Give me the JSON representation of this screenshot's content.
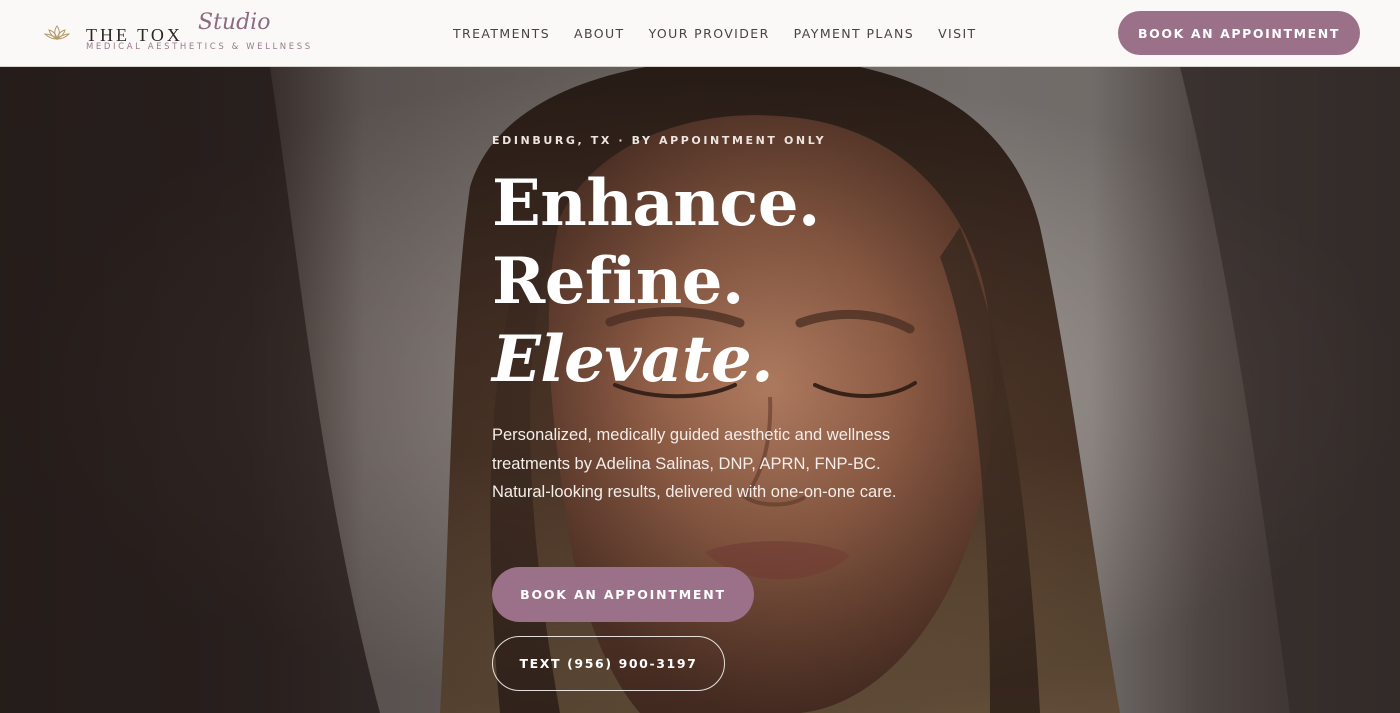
{
  "brand": {
    "name": "THE TOX",
    "script": "Studio",
    "tagline": "MEDICAL AESTHETICS & WELLNESS",
    "mark_icon": "lotus-icon",
    "accent_color": "#9b7189"
  },
  "nav": {
    "items": [
      {
        "label": "TREATMENTS"
      },
      {
        "label": "ABOUT"
      },
      {
        "label": "YOUR PROVIDER"
      },
      {
        "label": "PAYMENT PLANS"
      },
      {
        "label": "VISIT"
      }
    ],
    "cta_label": "BOOK AN APPOINTMENT"
  },
  "hero": {
    "eyebrow": "EDINBURG, TX · BY APPOINTMENT ONLY",
    "headline_line1": "Enhance.",
    "headline_line2": "Refine.",
    "headline_line3": "Elevate.",
    "description": "Personalized, medically guided aesthetic and wellness treatments by Adelina Salinas, DNP, APRN, FNP-BC. Natural-looking results, delivered with one-on-one care.",
    "primary_cta": "BOOK AN APPOINTMENT",
    "secondary_cta": "TEXT (956) 900-3197"
  }
}
